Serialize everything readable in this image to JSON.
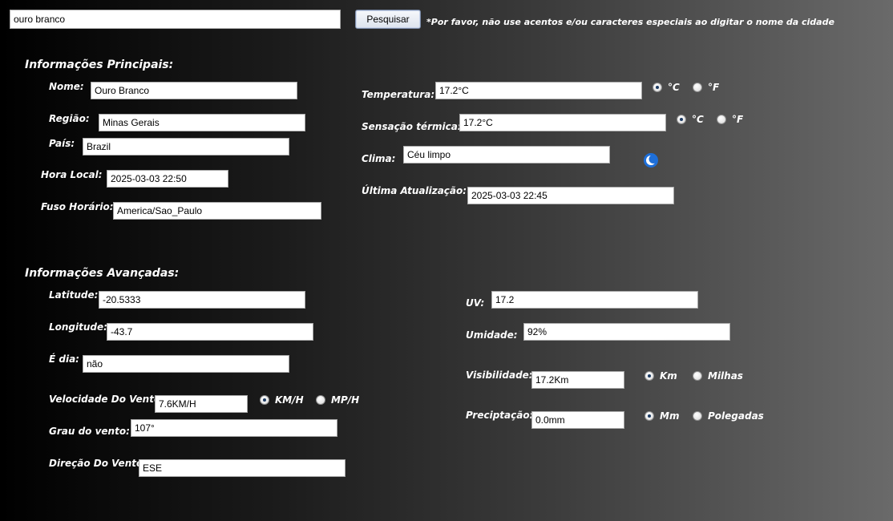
{
  "search": {
    "value": "ouro branco",
    "button_label": "Pesquisar",
    "note": "*Por favor, não use acentos e/ou caracteres especiais ao digitar o nome da cidade"
  },
  "main_info": {
    "title": "Informações Principais:",
    "name_label": "Nome:",
    "name_value": "Ouro Branco",
    "region_label": "Região:",
    "region_value": "Minas Gerais",
    "country_label": "País:",
    "country_value": "Brazil",
    "local_time_label": "Hora Local:",
    "local_time_value": "2025-03-03 22:50",
    "timezone_label": "Fuso Horário:",
    "timezone_value": "America/Sao_Paulo",
    "temperature_label": "Temperatura:",
    "temperature_value": "17.2°C",
    "feels_like_label": "Sensação térmica:",
    "feels_like_value": "17.2°C",
    "climate_label": "Clima:",
    "climate_value": "Céu limpo",
    "climate_icon": "crescent-moon-icon",
    "last_update_label": "Última Atualização:",
    "last_update_value": "2025-03-03 22:45",
    "unit_c": "°C",
    "unit_f": "°F",
    "temperature_unit_selected": "°C",
    "feels_like_unit_selected": "°C"
  },
  "advanced_info": {
    "title": "Informações Avançadas:",
    "latitude_label": "Latitude:",
    "latitude_value": "-20.5333",
    "longitude_label": "Longitude:",
    "longitude_value": "-43.7",
    "is_day_label": "É dia:",
    "is_day_value": "não",
    "wind_speed_label": "Velocidade Do Vento:",
    "wind_speed_value": "7.6KM/H",
    "wind_unit_kmh": "KM/H",
    "wind_unit_mph": "MP/H",
    "wind_unit_selected": "KM/H",
    "wind_degree_label": "Grau do vento:",
    "wind_degree_value": "107°",
    "wind_direction_label": "Direção Do Vento:",
    "wind_direction_value": "ESE",
    "uv_label": "UV:",
    "uv_value": "17.2",
    "humidity_label": "Umidade:",
    "humidity_value": "92%",
    "visibility_label": "Visibilidade:",
    "visibility_value": "17.2Km",
    "visibility_unit_km": "Km",
    "visibility_unit_miles": "Milhas",
    "visibility_unit_selected": "Km",
    "precipitation_label": "Preciptação:",
    "precipitation_value": "0.0mm",
    "precipitation_unit_mm": "Mm",
    "precipitation_unit_in": "Polegadas",
    "precipitation_unit_selected": "Mm"
  }
}
